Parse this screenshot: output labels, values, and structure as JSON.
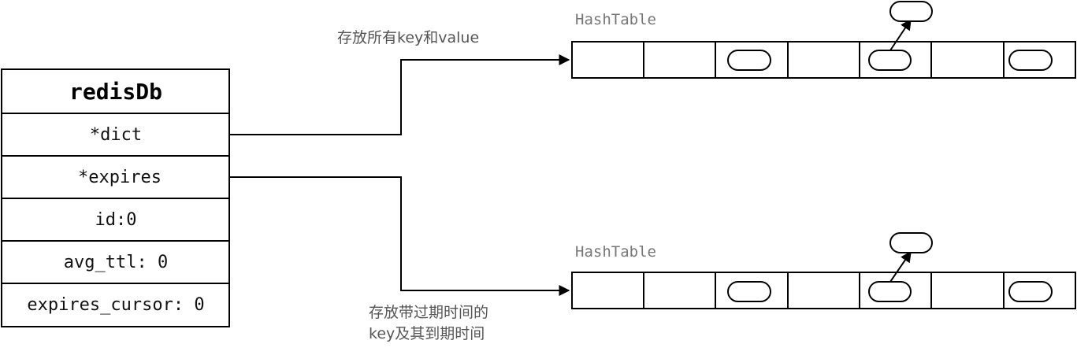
{
  "struct": {
    "title": "redisDb",
    "fields": [
      "*dict",
      "*expires",
      "id:0",
      "avg_ttl: 0",
      "expires_cursor: 0"
    ]
  },
  "hashtables": [
    {
      "label": "HashTable",
      "annotation_lines": [
        "存放所有key和value"
      ]
    },
    {
      "label": "HashTable",
      "annotation_lines": [
        "存放带过期时间的",
        "key及其到期时间"
      ]
    }
  ],
  "colors": {
    "line": "#000000",
    "label": "#777777",
    "annotation": "#555555"
  }
}
